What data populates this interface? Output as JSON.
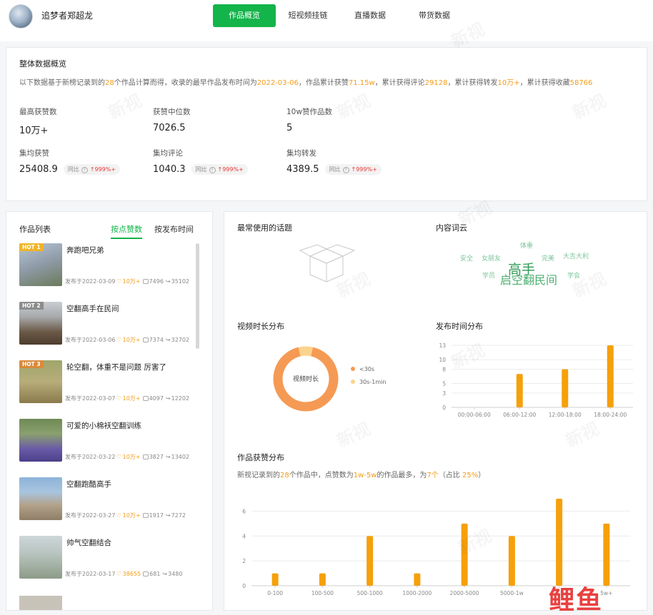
{
  "header": {
    "username": "追梦者郑超龙",
    "tabs": [
      "作品概览",
      "短视频挂链",
      "直播数据",
      "带货数据"
    ]
  },
  "overview": {
    "title": "整体数据概览",
    "desc": {
      "p1": "以下数据基于新榜记录到的",
      "works_count": "28",
      "p2": "个作品计算而得，收录的最早作品发布时间为",
      "earliest": "2022-03-06",
      "p3": "，作品累计获赞",
      "likes": "71.15w",
      "p4": "，累计获得评论",
      "comments": "29128",
      "p5": "，累计获得转发",
      "shares": "10万+",
      "p6": "，累计获得收藏",
      "favorites": "58766"
    },
    "metrics": [
      {
        "label": "最高获赞数",
        "value": "10万+"
      },
      {
        "label": "获赞中位数",
        "value": "7026.5"
      },
      {
        "label": "10w赞作品数",
        "value": "5"
      },
      {
        "label": "集均获赞",
        "value": "25408.9",
        "yoy": "同比",
        "change": "999%+"
      },
      {
        "label": "集均评论",
        "value": "1040.3",
        "yoy": "同比",
        "change": "999%+"
      },
      {
        "label": "集均转发",
        "value": "4389.5",
        "yoy": "同比",
        "change": "999%+"
      }
    ]
  },
  "works": {
    "title": "作品列表",
    "sort_likes": "按点赞数",
    "sort_time": "按发布时间",
    "items": [
      {
        "hot": "HOT 1",
        "title": "奔跑吧兄弟",
        "date": "发布于2022-03-09",
        "likes": "10万+",
        "comments": "7496",
        "shares": "35102"
      },
      {
        "hot": "HOT 2",
        "title": "空翻高手在民间",
        "date": "发布于2022-03-06",
        "likes": "10万+",
        "comments": "7374",
        "shares": "32702"
      },
      {
        "hot": "HOT 3",
        "title": "轮空翻，体重不是问题 厉害了",
        "date": "发布于2022-03-07",
        "likes": "10万+",
        "comments": "4097",
        "shares": "12202"
      },
      {
        "hot": "",
        "title": "可爱的小棉袄空翻训练",
        "date": "发布于2022-03-22",
        "likes": "10万+",
        "comments": "3827",
        "shares": "13402"
      },
      {
        "hot": "",
        "title": "空翻跑酷高手",
        "date": "发布于2022-03-27",
        "likes": "10万+",
        "comments": "1917",
        "shares": "7272"
      },
      {
        "hot": "",
        "title": "帅气空翻结合",
        "date": "发布于2022-03-17",
        "likes": "38655",
        "comments": "681",
        "shares": "3480"
      }
    ]
  },
  "analytics": {
    "topics_title": "最常使用的话题",
    "cloud_title": "内容词云",
    "cloud_words": [
      "体重",
      "安全",
      "女朋友",
      "完美",
      "大吉大利",
      "高手",
      "学员",
      "启空翻民间",
      "学会"
    ],
    "duration_title": "视频时长分布",
    "duration_center": "视频时长",
    "post_time_title": "发布时间分布",
    "likes_dist_title": "作品获赞分布",
    "likes_dist_desc": {
      "p1": "新视记录到的",
      "works": "28",
      "p2": "个作品中，点赞数为",
      "range": "1w-5w",
      "p3": "的作品最多，为",
      "count": "7个",
      "p4": "（占比 ",
      "ratio": "25%",
      "p5": "）"
    },
    "corner_logo": "鲤鱼"
  },
  "chart_data": [
    {
      "type": "pie",
      "title": "视频时长分布",
      "categories": [
        "<30s",
        "30s-1min"
      ],
      "values": [
        26,
        2
      ],
      "colors": [
        "#f59a54",
        "#fcd38c"
      ]
    },
    {
      "type": "bar",
      "title": "发布时间分布",
      "categories": [
        "00:00-06:00",
        "06:00-12:00",
        "12:00-18:00",
        "18:00-24:00"
      ],
      "values": [
        0,
        7,
        8,
        13
      ],
      "y_ticks": [
        0,
        3,
        5,
        8,
        10,
        13
      ],
      "ylim": [
        0,
        13
      ],
      "color": "#f6a00a"
    },
    {
      "type": "bar",
      "title": "作品获赞分布",
      "categories": [
        "0-100",
        "100-500",
        "500-1000",
        "1000-2000",
        "2000-5000",
        "5000-1w",
        "1w-5w",
        "5w+"
      ],
      "values": [
        1,
        1,
        4,
        1,
        5,
        4,
        7,
        5
      ],
      "y_ticks": [
        0,
        2,
        4,
        6
      ],
      "ylim": [
        0,
        7
      ],
      "color": "#f6a00a"
    }
  ]
}
